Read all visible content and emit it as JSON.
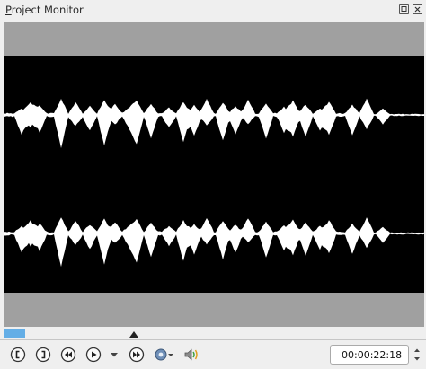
{
  "window": {
    "title_prefix": "P",
    "title_rest": "roject Monitor"
  },
  "titlebar_buttons": {
    "float_icon": "float-icon",
    "close_icon": "close-icon"
  },
  "transport": {
    "buttons": [
      {
        "name": "set-zone-start-button",
        "icon": "bracket-left-icon"
      },
      {
        "name": "set-zone-end-button",
        "icon": "bracket-right-icon"
      },
      {
        "name": "rewind-button",
        "icon": "rewind-icon"
      },
      {
        "name": "play-button",
        "icon": "play-icon"
      },
      {
        "name": "play-menu-button",
        "icon": "chevron-down-icon"
      },
      {
        "name": "forward-button",
        "icon": "fast-forward-icon"
      },
      {
        "name": "monitor-options-button",
        "icon": "gear-icon"
      },
      {
        "name": "volume-button",
        "icon": "speaker-icon"
      }
    ]
  },
  "timecode": {
    "value": "00:00:22:18"
  },
  "colors": {
    "accent": "#64aee6",
    "monitor_bg": "#a0a0a0",
    "wave_bg": "#000000",
    "wave": "#ffffff"
  }
}
